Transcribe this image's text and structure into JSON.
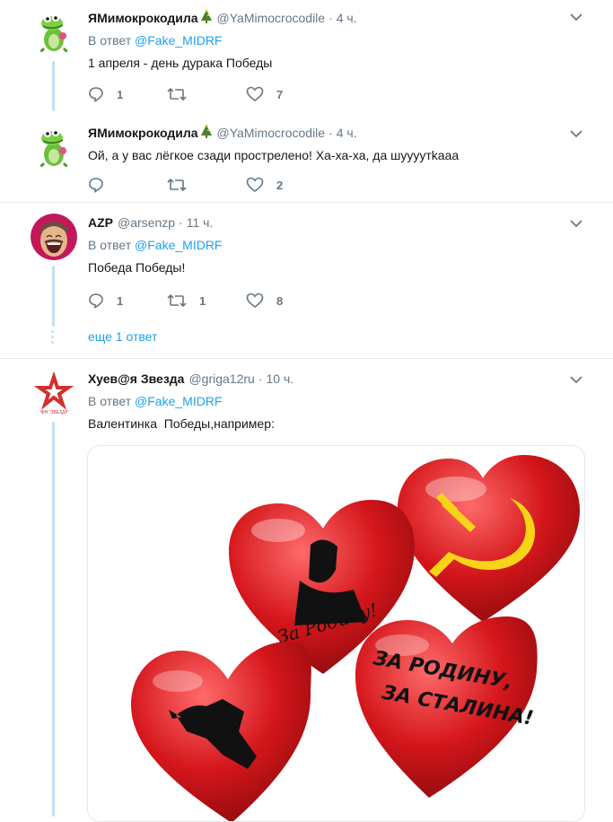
{
  "tweets": [
    {
      "name": "ЯМимокрокодила",
      "name_emoji": "christmas-tree-icon",
      "handle": "@YaMimocrocodile",
      "time": "4 ч.",
      "reply_prefix": "В ответ",
      "reply_to": "@Fake_MIDRF",
      "text": "1 апреля - день дурака Победы",
      "replies": "1",
      "retweets": "",
      "likes": "7"
    },
    {
      "name": "ЯМимокрокодила",
      "name_emoji": "christmas-tree-icon",
      "handle": "@YaMimocrocodile",
      "time": "4 ч.",
      "text": "Ой, а у вас лёгкое сзади прострелено! Ха-ха-ха, да шуууутkaaa",
      "replies": "",
      "retweets": "",
      "likes": "2"
    },
    {
      "name": "AZP",
      "handle": "@arsenzp",
      "time": "11 ч.",
      "reply_prefix": "В ответ",
      "reply_to": "@Fake_MIDRF",
      "text": "Победа Победы!",
      "replies": "1",
      "retweets": "1",
      "likes": "8"
    },
    {
      "name": "Хуев@я Звезда",
      "handle": "@griga12ru",
      "time": "10 ч.",
      "reply_prefix": "В ответ",
      "reply_to": "@Fake_MIDRF",
      "text": "Валентинка  Победы,например:"
    }
  ],
  "show_more": "еще 1 ответ",
  "avatar_star_caption": "ЧФН \"ЗВЕЗДА\"",
  "hearts": {
    "heart2_text": "За Родину!",
    "heart4_line1": "ЗА РОДИНУ,",
    "heart4_line2": "ЗА СТАЛИНА!"
  },
  "colors": {
    "link": "#1da1f2",
    "muted": "#657786",
    "thread": "#c4dff0",
    "heart": "#d4161b"
  }
}
